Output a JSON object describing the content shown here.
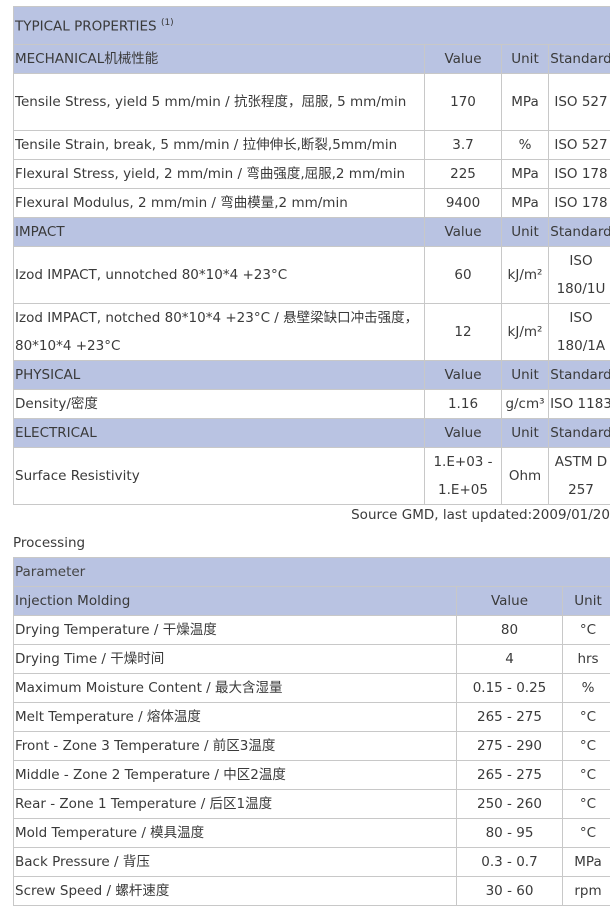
{
  "properties": {
    "title": "TYPICAL PROPERTIES",
    "title_sup": "(1)",
    "sections": [
      {
        "name": "MECHANICAL机械性能",
        "headers": [
          "Value",
          "Unit",
          "Standard"
        ],
        "rows": [
          {
            "label": "Tensile Stress, yield 5 mm/min / 抗张程度，屈服, 5 mm/min",
            "value": "170",
            "unit": "MPa",
            "standard": "ISO 527"
          },
          {
            "label": "Tensile Strain, break, 5 mm/min / 拉伸伸长,断裂,5mm/min",
            "value": "3.7",
            "unit": "%",
            "standard": "ISO 527"
          },
          {
            "label": "Flexural Stress, yield, 2 mm/min / 弯曲强度,屈服,2 mm/min",
            "value": "225",
            "unit": "MPa",
            "standard": "ISO 178"
          },
          {
            "label": "Flexural Modulus, 2 mm/min / 弯曲模量,2 mm/min",
            "value": "9400",
            "unit": "MPa",
            "standard": "ISO 178"
          }
        ]
      },
      {
        "name": "IMPACT",
        "headers": [
          "Value",
          "Unit",
          "Standard"
        ],
        "rows": [
          {
            "label": "Izod IMPACT, unnotched 80*10*4 +23°C",
            "value": "60",
            "unit": "kJ/m²",
            "standard": "ISO 180/1U"
          },
          {
            "label": "Izod IMPACT, notched 80*10*4 +23°C / 悬壁梁缺口冲击强度，80*10*4 +23°C",
            "value": "12",
            "unit": "kJ/m²",
            "standard": "ISO 180/1A"
          }
        ]
      },
      {
        "name": "PHYSICAL",
        "headers": [
          "Value",
          "Unit",
          "Standard"
        ],
        "rows": [
          {
            "label": "Density/密度",
            "value": "1.16",
            "unit": "g/cm³",
            "standard": "ISO 1183"
          }
        ]
      },
      {
        "name": "ELECTRICAL",
        "headers": [
          "Value",
          "Unit",
          "Standard"
        ],
        "rows": [
          {
            "label": "Surface Resistivity",
            "value": "1.E+03 - 1.E+05",
            "unit": "Ohm",
            "standard": "ASTM D 257"
          }
        ]
      }
    ],
    "source_note": "Source GMD, last updated:2009/01/20"
  },
  "processing": {
    "label": "Processing",
    "header": "Parameter",
    "section_name": "Injection Molding",
    "headers": [
      "Value",
      "Unit"
    ],
    "rows": [
      {
        "label": "Drying Temperature / 干燥温度",
        "value": "80",
        "unit": "°C"
      },
      {
        "label": "Drying Time / 干燥时间",
        "value": "4",
        "unit": "hrs"
      },
      {
        "label": "Maximum Moisture Content / 最大含湿量",
        "value": "0.15 - 0.25",
        "unit": "%"
      },
      {
        "label": "Melt Temperature / 熔体温度",
        "value": "265 - 275",
        "unit": "°C"
      },
      {
        "label": "Front - Zone 3 Temperature / 前区3温度",
        "value": "275 - 290",
        "unit": "°C"
      },
      {
        "label": "Middle - Zone 2 Temperature / 中区2温度",
        "value": "265 - 275",
        "unit": "°C"
      },
      {
        "label": "Rear - Zone 1 Temperature / 后区1温度",
        "value": "250 - 260",
        "unit": "°C"
      },
      {
        "label": "Mold Temperature / 模具温度",
        "value": "80 - 95",
        "unit": "°C"
      },
      {
        "label": "Back Pressure / 背压",
        "value": "0.3 - 0.7",
        "unit": "MPa"
      },
      {
        "label": "Screw Speed / 螺杆速度",
        "value": "30 - 60",
        "unit": "rpm"
      }
    ]
  }
}
